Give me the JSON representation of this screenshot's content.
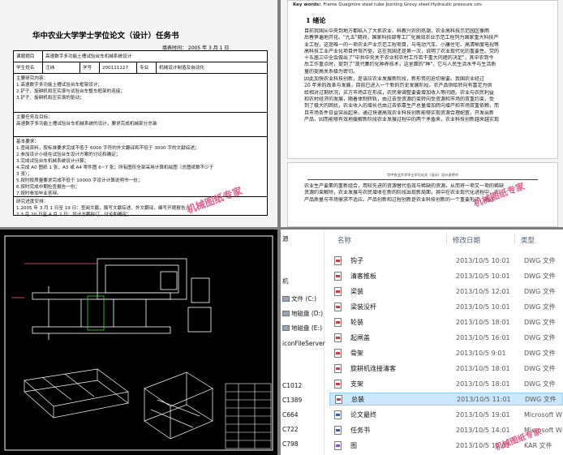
{
  "task_doc": {
    "title": "华中农业大学学士学位论文（设计）任务书",
    "fill_date": "填表时间：    2005    年    3    月    1    日",
    "topic_label": "课题题目",
    "topic_value": "高速数字多功能土槽试验台车机械系统设计",
    "student_label": "学生姓名",
    "student_value": "汪纬",
    "id_label": "学号",
    "id_value": "200111127",
    "major_label": "专业",
    "major_value": "机械设计制造及自动化",
    "content_lines": [
      "主要研究内容：",
      "  1.高速数字多功能土槽试验台车框架设计；",
      "  2.铲子、旋耕机和压实滚与试验台车整车框架的连接；",
      "  3.铲子、旋耕机和压实滚的驱动；"
    ],
    "goal_lines": [
      "主要任务及目标：",
      "  高速数字多功能土槽试验台车机械系统的设计，要求完成机械部分总装"
    ],
    "req_lines": [
      "基本要求：",
      "  1.查阅资料，按标准要求完成不低于 6000 字符的外文翻译和不低于 3000 字的文献综述；",
      "  2.参加设计小组在试验台车设计方案的讨论和确定；",
      "  3.完成试验台车机械系统设计计算；",
      "  4.完成 A0 图纸 1 张，A3 或 A4 零件图 6~7 张；所有图形全部采用计算机绘图（总图纸数不少于",
      "     3 张）；",
      "  5.按时按质量要求完成不低于 10000 字设计计算说明书一份；",
      "  6.按时完成中期检查报告一份；",
      "  7.按时参加毕业答辩。"
    ],
    "schedule_lines": [
      "研究进度安排：",
      "  1.2005 年 3 月 1 日至 19 日：查阅文献，撰写文献综述、外文翻译，编写开题报告；",
      "  2.3 月 20 日至 4 月 2 日：设计方案拟订，讨论和确定；"
    ],
    "stamp": "机械图纸专家"
  },
  "thesis": {
    "keywords_label": "Key words:",
    "keywords": "Frame    Quagmire steel tube    Jointing    Grovy steel    Hydraulic pressure um-",
    "heading": "1  绪论",
    "para1": [
      "    目前我国从中央到地方都陷入了大抓农业、科教兴农的热潮，农业高科技示范园区像雨",
      "后春笋遍地开花。\"九五\"期间，国家科技部等工厂化高效农业示范工程列为国家重大科技产",
      "业工程，这是唯一的一项农业产业示范工程项目，与电动汽车、小康住宅、高清晰度电视等",
      "高科技工业产业化项目并驾齐驱，这在我国还是第一次，说明了农业现代化的重要性。党的",
      "十五届三中全会做出了\"中共中央关于农业和农村工作若干重大问题的决定\"，其中农到今",
      "后工作重点时，提到了\"现代集约化种养技术，这里面的\"种\"，它与人民生活水平与生活质",
      "量的提高关系极为密切。"
    ],
    "para2": [
      "    因此加快农业科技创新，是该应农业发展新阶段，新形势的迫切需要。我国农业经过",
      "20 年来的改革与发展，目前已进入一个新的历史发展阶段。农产品供给转向有富足为供",
      "给相对过剩状况，买方市场正在形成，农民需调整要要增加收入等问题。农业与农民利益",
      "和农村经济的发展，随着体制转轨，由过去受资源约束转向受资源和市场的双重约束，受",
      "到了极大的困扰，农业收入的增长也由过去依靠生产总量增加转向增产和市场双重依赖，而",
      "且市场条件日益突出起来，通过快速高效农业科技创新能够实现资源合理配置，开发出新",
      "产品，因而能够有效地缓解新阶段农业发展过程中的两个矛盾来，农业科技创新越来越实现"
    ],
    "page2_header": "华中农业大学学士学位论文（设计）设计说明书",
    "para3": [
      "农业生产要素的重新组合，用较先进的资源替代低效与稀缺的资源，从而将一项又一项的稀缺",
      "资源约束解除，农业发展与农民增收在新的阶段出现新局面，其中在农业现代化进程中，农",
      "产品质量与市场需求不适应。产品创新和过程创新是农业科技创新的一个重要形式，通过"
    ],
    "stamp": "机械图纸专家"
  },
  "cad": {
    "stamp": "机械图纸专家"
  },
  "explorer": {
    "nav_items": [
      "机",
      "文件 (C:)",
      "地磁盘 (D:)",
      "地磁盘 (E:)",
      "iconFileServer",
      "C1012",
      "C1389",
      "C664",
      "C722",
      "C798"
    ],
    "nav_partial_top": "源",
    "columns": {
      "name": "名称",
      "date": "修改日期",
      "type": "类型"
    },
    "files": [
      {
        "name": "钩子",
        "date": "2013/10/5 10:01",
        "type": "DWG 文件",
        "icon": "dwg"
      },
      {
        "name": "清客推板",
        "date": "2013/10/5 10:01",
        "type": "DWG 文件",
        "icon": "dwg"
      },
      {
        "name": "梁装",
        "date": "2013/10/5 12:01",
        "type": "DWG 文件",
        "icon": "dwg"
      },
      {
        "name": "梁装没杆",
        "date": "2013/10/5 10:01",
        "type": "DWG 文件",
        "icon": "dwg"
      },
      {
        "name": "轮装",
        "date": "2013/10/5 18:01",
        "type": "DWG 文件",
        "icon": "dwg"
      },
      {
        "name": "起闸盖",
        "date": "2013/10/5 16:01",
        "type": "DWG 文件",
        "icon": "dwg"
      },
      {
        "name": "骨架",
        "date": "2013/10/5 9:01",
        "type": "DWG 文件",
        "icon": "dwg"
      },
      {
        "name": "旋耕机连接清客",
        "date": "2013/10/5 18:01",
        "type": "DWG 文件",
        "icon": "dwg"
      },
      {
        "name": "支架",
        "date": "2013/10/5 18:01",
        "type": "DWG 文件",
        "icon": "dwg"
      },
      {
        "name": "总装",
        "date": "2013/10/5 11:01",
        "type": "DWG 文件",
        "icon": "dwg",
        "selected": true
      },
      {
        "name": "论文最终",
        "date": "2013/10/5 19:01",
        "type": "Microsoft W",
        "icon": "doc"
      },
      {
        "name": "任务书",
        "date": "2013/10/5 14:01",
        "type": "Microsoft W",
        "icon": "doc"
      },
      {
        "name": "图",
        "date": "2013/10/5 15:01",
        "type": "KAR 文件",
        "icon": "rar"
      }
    ],
    "stamp": "机械图纸专家"
  }
}
